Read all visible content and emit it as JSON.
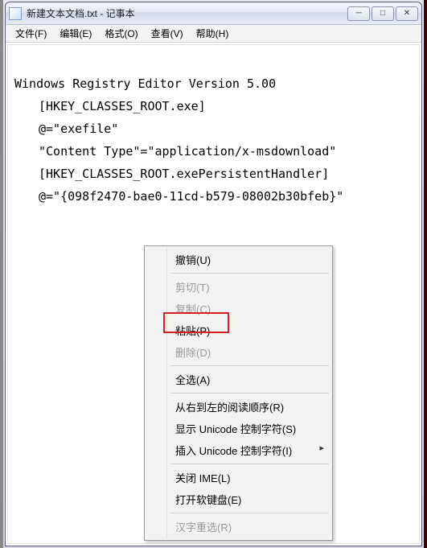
{
  "titlebar": {
    "title": "新建文本文档.txt - 记事本"
  },
  "menubar": {
    "file": "文件(F)",
    "edit": "编辑(E)",
    "format": "格式(O)",
    "view": "查看(V)",
    "help": "帮助(H)"
  },
  "editor": {
    "line1": "Windows Registry Editor Version 5.00",
    "line2": "　　[HKEY_CLASSES_ROOT.exe]",
    "line3": "　　@=\"exefile\"",
    "line4": "　　\"Content Type\"=\"application/x-msdownload\"",
    "line5": "　　[HKEY_CLASSES_ROOT.exePersistentHandler]",
    "line6": "　　@=\"{098f2470-bae0-11cd-b579-08002b30bfeb}\""
  },
  "context_menu": {
    "undo": "撤销(U)",
    "cut": "剪切(T)",
    "copy": "复制(C)",
    "paste": "粘贴(P)",
    "delete": "删除(D)",
    "select_all": "全选(A)",
    "rtl": "从右到左的阅读顺序(R)",
    "show_unicode": "显示 Unicode 控制字符(S)",
    "insert_unicode": "插入 Unicode 控制字符(I)",
    "close_ime": "关闭 IME(L)",
    "soft_keyboard": "打开软键盘(E)",
    "hanzi": "汉字重选(R)"
  }
}
